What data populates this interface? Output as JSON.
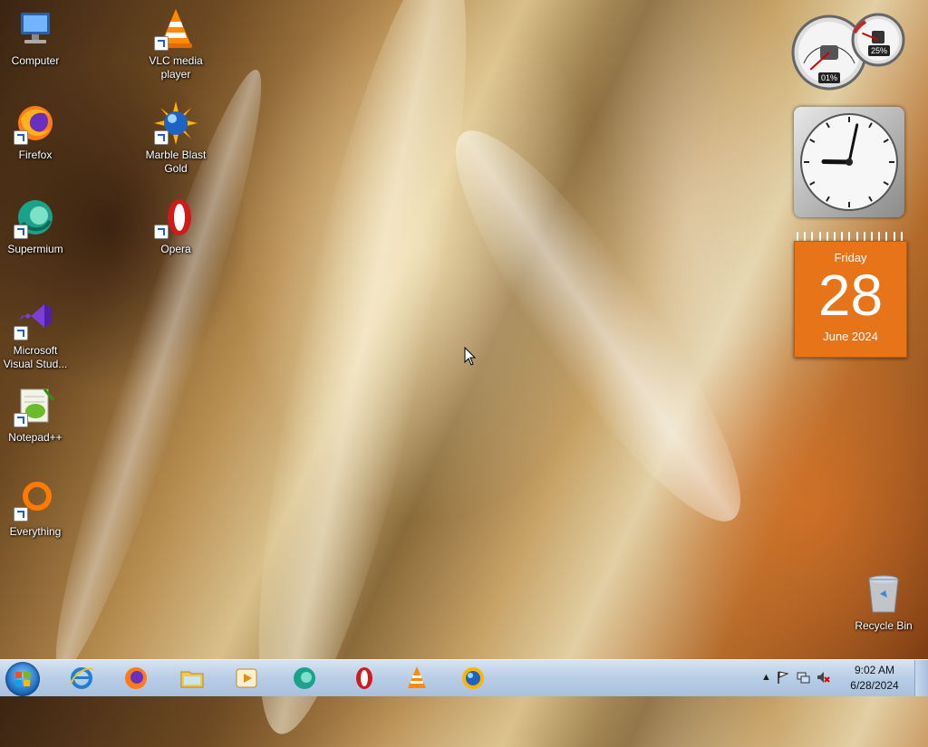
{
  "desktop": {
    "icons": [
      {
        "id": "computer",
        "label_lines": [
          "Computer"
        ]
      },
      {
        "id": "firefox",
        "label_lines": [
          "Firefox"
        ]
      },
      {
        "id": "supermium",
        "label_lines": [
          "Supermium"
        ]
      },
      {
        "id": "vs",
        "label_lines": [
          "Microsoft",
          "Visual Stud..."
        ]
      },
      {
        "id": "notepadpp",
        "label_lines": [
          "Notepad++"
        ]
      },
      {
        "id": "everything",
        "label_lines": [
          "Everything"
        ]
      },
      {
        "id": "vlc",
        "label_lines": [
          "VLC media",
          "player"
        ]
      },
      {
        "id": "marble",
        "label_lines": [
          "Marble Blast",
          "Gold"
        ]
      },
      {
        "id": "opera",
        "label_lines": [
          "Opera"
        ]
      },
      {
        "id": "recycle",
        "label_lines": [
          "Recycle Bin"
        ]
      }
    ]
  },
  "gadgets": {
    "cpu_meter": {
      "cpu_text": "01%",
      "memory_text": "25%",
      "cpu_fraction": 0.01,
      "memory_fraction": 0.25
    },
    "clock": {
      "hour": 9,
      "minute": 2
    },
    "calendar": {
      "weekday": "Friday",
      "day": "28",
      "month_year": "June 2024",
      "color": "#e8741a"
    }
  },
  "taskbar": {
    "start_label": "Start",
    "pinned": [
      "internet-explorer",
      "firefox",
      "file-explorer",
      "media-player",
      "supermium",
      "opera",
      "vlc",
      "marble-blast"
    ],
    "tray": {
      "time": "9:02 AM",
      "date": "6/28/2024",
      "show_hidden": "▲"
    }
  }
}
